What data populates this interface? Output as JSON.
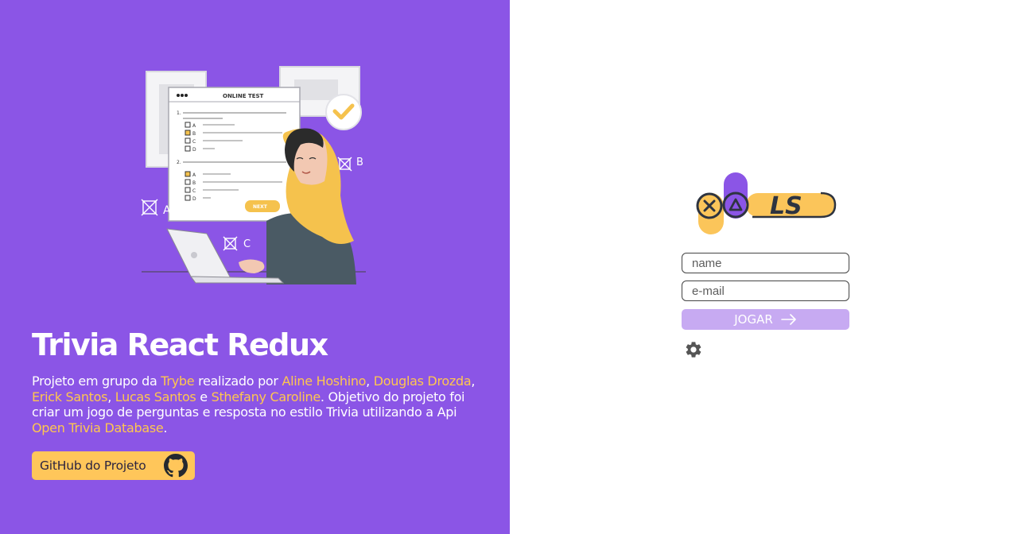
{
  "hero": {
    "title": "Trivia React Redux",
    "description": {
      "t1": "Projeto em grupo da ",
      "trybe": "Trybe",
      "t2": " realizado por ",
      "aline": "Aline Hoshino",
      "c1": ", ",
      "douglas": "Douglas Drozda",
      "c2": ", ",
      "erick": "Erick Santos",
      "c3": ", ",
      "lucas": "Lucas Santos",
      "t3": " e ",
      "sthefany": "Sthefany Caroline",
      "t4": ". Objetivo do projeto foi criar um jogo de perguntas e resposta no estilo Trivia utilizando a Api ",
      "api": "Open Trivia Database",
      "t5": "."
    },
    "github_label": "GitHub do Projeto"
  },
  "illustration": {
    "card_title": "ONLINE TEST",
    "q1": "1.",
    "q2": "2.",
    "opt_a": "A",
    "opt_b": "B",
    "opt_c": "C",
    "opt_d": "D",
    "next_label": "NEXT",
    "float_a": "A",
    "float_b": "B",
    "float_c": "C"
  },
  "logo": {
    "text": "LS"
  },
  "form": {
    "name_placeholder": "name",
    "email_placeholder": "e-mail",
    "play_label": "JOGAR"
  },
  "colors": {
    "left_bg": "#8b55e6",
    "accent_yellow": "#ffc64f",
    "button_purple_light": "#c7aaf2"
  },
  "icons": {
    "github": "github-icon",
    "arrow": "arrow-right-icon",
    "settings": "gear-icon"
  }
}
